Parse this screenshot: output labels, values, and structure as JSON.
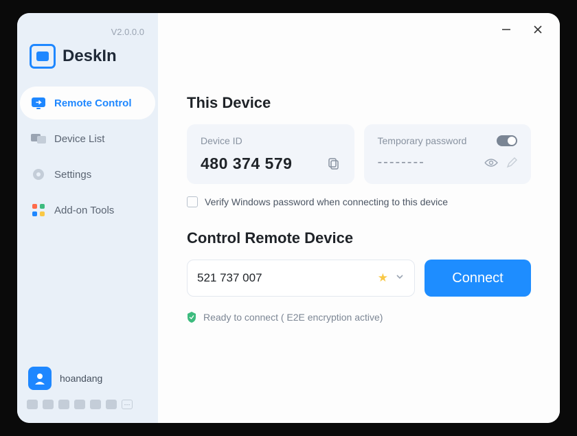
{
  "version": "V2.0.0.0",
  "brand": "DeskIn",
  "sidebar": {
    "items": [
      {
        "label": "Remote Control"
      },
      {
        "label": "Device List"
      },
      {
        "label": "Settings"
      },
      {
        "label": "Add-on Tools"
      }
    ]
  },
  "user": {
    "name": "hoandang"
  },
  "thisDevice": {
    "heading": "This Device",
    "idLabel": "Device ID",
    "idValue": "480 374 579",
    "pwLabel": "Temporary password",
    "pwMask": "--------",
    "verifyLabel": "Verify Windows password when connecting to this device"
  },
  "remote": {
    "heading": "Control Remote Device",
    "inputValue": "521 737 007",
    "connectLabel": "Connect",
    "status": "Ready to connect ( E2E encryption active)"
  }
}
